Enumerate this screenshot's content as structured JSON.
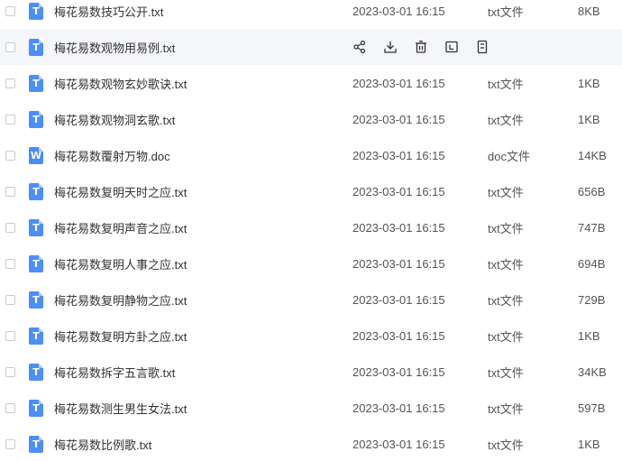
{
  "files": [
    {
      "name": "梅花易数技巧公开.txt",
      "date": "2023-03-01 16:15",
      "type": "txt文件",
      "size": "8KB",
      "icon": "T",
      "icon_kind": "txt"
    },
    {
      "name": "梅花易数观物用易例.txt",
      "date": "",
      "type": "",
      "size": "",
      "icon": "T",
      "icon_kind": "txt",
      "hovered": true
    },
    {
      "name": "梅花易数观物玄妙歌诀.txt",
      "date": "2023-03-01 16:15",
      "type": "txt文件",
      "size": "1KB",
      "icon": "T",
      "icon_kind": "txt"
    },
    {
      "name": "梅花易数观物洞玄歌.txt",
      "date": "2023-03-01 16:15",
      "type": "txt文件",
      "size": "1KB",
      "icon": "T",
      "icon_kind": "txt"
    },
    {
      "name": "梅花易数覆射万物.doc",
      "date": "2023-03-01 16:15",
      "type": "doc文件",
      "size": "14KB",
      "icon": "W",
      "icon_kind": "doc"
    },
    {
      "name": "梅花易数复明天时之应.txt",
      "date": "2023-03-01 16:15",
      "type": "txt文件",
      "size": "656B",
      "icon": "T",
      "icon_kind": "txt"
    },
    {
      "name": "梅花易数复明声音之应.txt",
      "date": "2023-03-01 16:15",
      "type": "txt文件",
      "size": "747B",
      "icon": "T",
      "icon_kind": "txt"
    },
    {
      "name": "梅花易数复明人事之应.txt",
      "date": "2023-03-01 16:15",
      "type": "txt文件",
      "size": "694B",
      "icon": "T",
      "icon_kind": "txt"
    },
    {
      "name": "梅花易数复明静物之应.txt",
      "date": "2023-03-01 16:15",
      "type": "txt文件",
      "size": "729B",
      "icon": "T",
      "icon_kind": "txt"
    },
    {
      "name": "梅花易数复明方卦之应.txt",
      "date": "2023-03-01 16:15",
      "type": "txt文件",
      "size": "1KB",
      "icon": "T",
      "icon_kind": "txt"
    },
    {
      "name": "梅花易数拆字五言歌.txt",
      "date": "2023-03-01 16:15",
      "type": "txt文件",
      "size": "34KB",
      "icon": "T",
      "icon_kind": "txt"
    },
    {
      "name": "梅花易数测生男生女法.txt",
      "date": "2023-03-01 16:15",
      "type": "txt文件",
      "size": "597B",
      "icon": "T",
      "icon_kind": "txt"
    },
    {
      "name": "梅花易数比例歌.txt",
      "date": "2023-03-01 16:15",
      "type": "txt文件",
      "size": "1KB",
      "icon": "T",
      "icon_kind": "txt"
    }
  ],
  "hover_actions": [
    {
      "icon": "share-icon"
    },
    {
      "icon": "download-icon"
    },
    {
      "icon": "delete-icon"
    },
    {
      "icon": "rename-icon"
    },
    {
      "icon": "more-icon"
    }
  ],
  "colors": {
    "accent": "#4d8ef8",
    "hover_bg": "#f5f6fa",
    "text": "#333333",
    "muted": "#555555"
  }
}
